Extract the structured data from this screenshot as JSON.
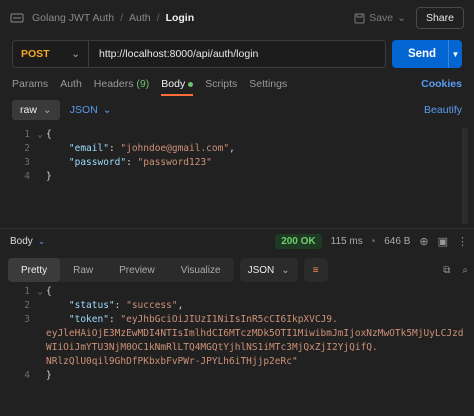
{
  "header": {
    "breadcrumb": [
      "Golang JWT Auth",
      "Auth",
      "Login"
    ],
    "save_label": "Save",
    "share_label": "Share"
  },
  "request": {
    "method": "POST",
    "url": "http://localhost:8000/api/auth/login",
    "send_label": "Send"
  },
  "tabs": {
    "params": "Params",
    "auth": "Auth",
    "headers": "Headers",
    "headers_count": "(9)",
    "body": "Body",
    "scripts": "Scripts",
    "settings": "Settings",
    "cookies": "Cookies"
  },
  "body_options": {
    "mode": "raw",
    "format": "JSON",
    "beautify": "Beautify"
  },
  "request_body": {
    "lines": [
      "1",
      "2",
      "3",
      "4"
    ],
    "open": "{",
    "close": "}",
    "email_key": "\"email\"",
    "email_val": "\"johndoe@gmail.com\"",
    "password_key": "\"password\"",
    "password_val": "\"password123\""
  },
  "response": {
    "label": "Body",
    "status": "200 OK",
    "time": "115 ms",
    "size": "646 B",
    "view_tabs": [
      "Pretty",
      "Raw",
      "Preview",
      "Visualize"
    ],
    "format": "JSON",
    "lines": [
      "1",
      "2",
      "3",
      "4"
    ],
    "status_key": "\"status\"",
    "status_val": "\"success\"",
    "token_key": "\"token\"",
    "token_parts": [
      "\"eyJhbGciOiJIUzI1NiIsInR5cCI6IkpXVCJ9.",
      "eyJleHAiOjE3MzEwMDI4NTIsImlhdCI6MTczMDk5OTI1MiwibmJmIjoxNzMwOTk5MjUyLCJzd",
      "WIiOiJmYTU3NjM0OC1kNmRlLTQ4MGQtYjhlNS1iMTc3MjQxZjI2YjQifQ.",
      "NRlzQlU0qil9GhDfPKbxbFvPWr-JPYLh6iTHjjp2eRc\""
    ]
  }
}
